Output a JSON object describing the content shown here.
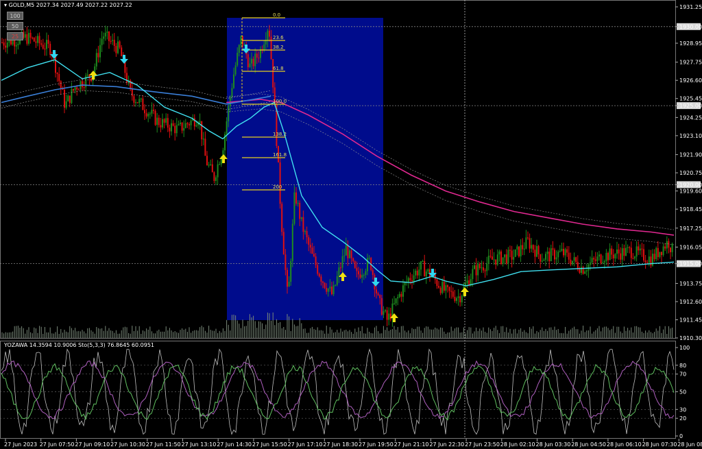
{
  "header": {
    "symbol_text": "GOLD,M5",
    "ohlc_text": "2027.34 2027.49 2027.22 2027.22"
  },
  "lot_buttons": [
    "100",
    "50",
    "25"
  ],
  "indicator_header": {
    "name": "YOZAWA",
    "values": "14.3594 10.9006",
    "stoch_label": "Sto(5,3,3)",
    "stoch_values": "76.8645 60.0951"
  },
  "price_axis": {
    "ticks": [
      "1931.25",
      "1930.00",
      "1928.95",
      "1927.75",
      "1926.60",
      "1925.45",
      "1925.00",
      "1924.25",
      "1923.10",
      "1921.90",
      "1920.75",
      "1920.00",
      "1919.60",
      "1918.45",
      "1917.25",
      "1916.05",
      "1915.00",
      "1913.75",
      "1912.60",
      "1911.45",
      "1910.30"
    ],
    "highlighted": [
      "1930.00",
      "1925.00",
      "1920.00",
      "1915.00"
    ]
  },
  "oscillator_axis": {
    "ticks": [
      "100",
      "80",
      "70",
      "50",
      "30",
      "20",
      "0"
    ]
  },
  "time_axis": {
    "labels": [
      "27 Jun 2023",
      "27 Jun 07:50",
      "27 Jun 09:10",
      "27 Jun 10:30",
      "27 Jun 11:50",
      "27 Jun 13:10",
      "27 Jun 14:30",
      "27 Jun 15:50",
      "27 Jun 17:10",
      "27 Jun 18:30",
      "27 Jun 19:50",
      "27 Jun 21:10",
      "27 Jun 22:30",
      "27 Jun 23:50",
      "28 Jun 02:10",
      "28 Jun 03:30",
      "28 Jun 04:50",
      "28 Jun 06:10",
      "28 Jun 07:30",
      "28 Jun 08:50"
    ]
  },
  "fibonacci": {
    "levels": [
      "0.0",
      "23.6",
      "38.2",
      "61.8",
      "100.0",
      "138.2",
      "161.8",
      "200"
    ],
    "color": "#e8d020"
  },
  "colors": {
    "bull_candle": "#1e8c1e",
    "bear_candle": "#e01010",
    "fast_ma": "#40e0f0",
    "slow_ma": "#e02890",
    "mid_ma": "#3a7fd8",
    "highlight_box": "#000c8c",
    "stoch_main": "#c0c0c0",
    "stoch_signal_a": "#b060c0",
    "stoch_signal_b": "#60c060",
    "up_arrow": "#f0e010",
    "down_arrow": "#30d8f0"
  }
}
